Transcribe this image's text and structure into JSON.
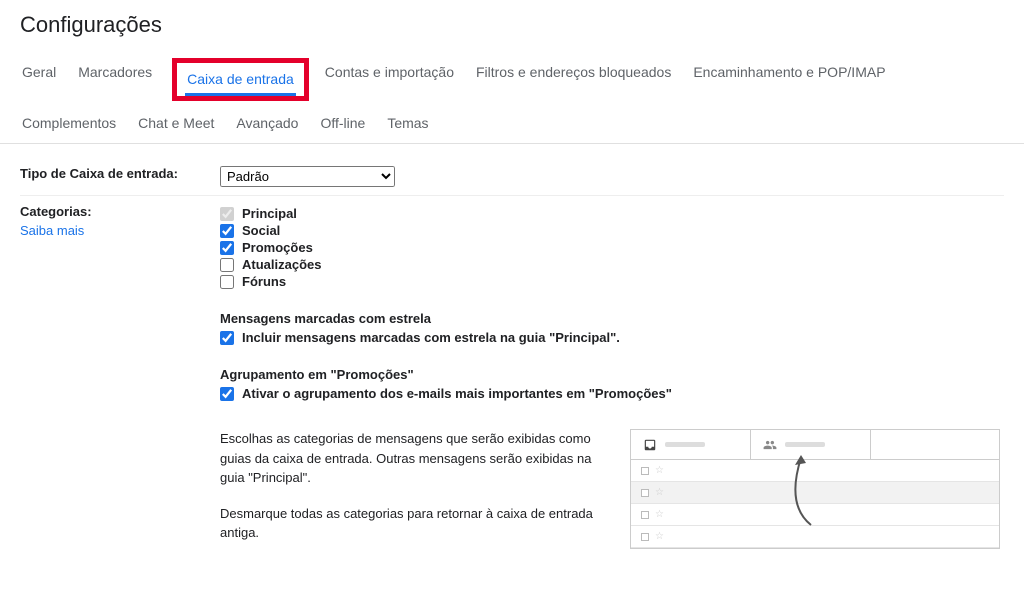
{
  "title": "Configurações",
  "tabs": {
    "row1": [
      "Geral",
      "Marcadores",
      "Caixa de entrada",
      "Contas e importação",
      "Filtros e endereços bloqueados",
      "Encaminhamento e POP/IMAP",
      "Complementos"
    ],
    "row2": [
      "Chat e Meet",
      "Avançado",
      "Off-line",
      "Temas"
    ],
    "active": "Caixa de entrada"
  },
  "inboxType": {
    "label": "Tipo de Caixa de entrada:",
    "value": "Padrão"
  },
  "categories": {
    "label": "Categorias:",
    "moreLink": "Saiba mais",
    "items": [
      {
        "label": "Principal",
        "checked": true,
        "disabled": true
      },
      {
        "label": "Social",
        "checked": true,
        "disabled": false
      },
      {
        "label": "Promoções",
        "checked": true,
        "disabled": false
      },
      {
        "label": "Atualizações",
        "checked": false,
        "disabled": false
      },
      {
        "label": "Fóruns",
        "checked": false,
        "disabled": false
      }
    ],
    "starredHeader": "Mensagens marcadas com estrela",
    "starredOption": {
      "label": "Incluir mensagens marcadas com estrela na guia \"Principal\".",
      "checked": true
    },
    "promoHeader": "Agrupamento em \"Promoções\"",
    "promoOption": {
      "label": "Ativar o agrupamento dos e-mails mais importantes em \"Promoções\"",
      "checked": true
    },
    "descPara1": "Escolhas as categorias de mensagens que serão exibidas como guias da caixa de entrada. Outras mensagens serão exibidas na guia \"Principal\".",
    "descPara2": "Desmarque todas as categorias para retornar à caixa de entrada antiga."
  }
}
